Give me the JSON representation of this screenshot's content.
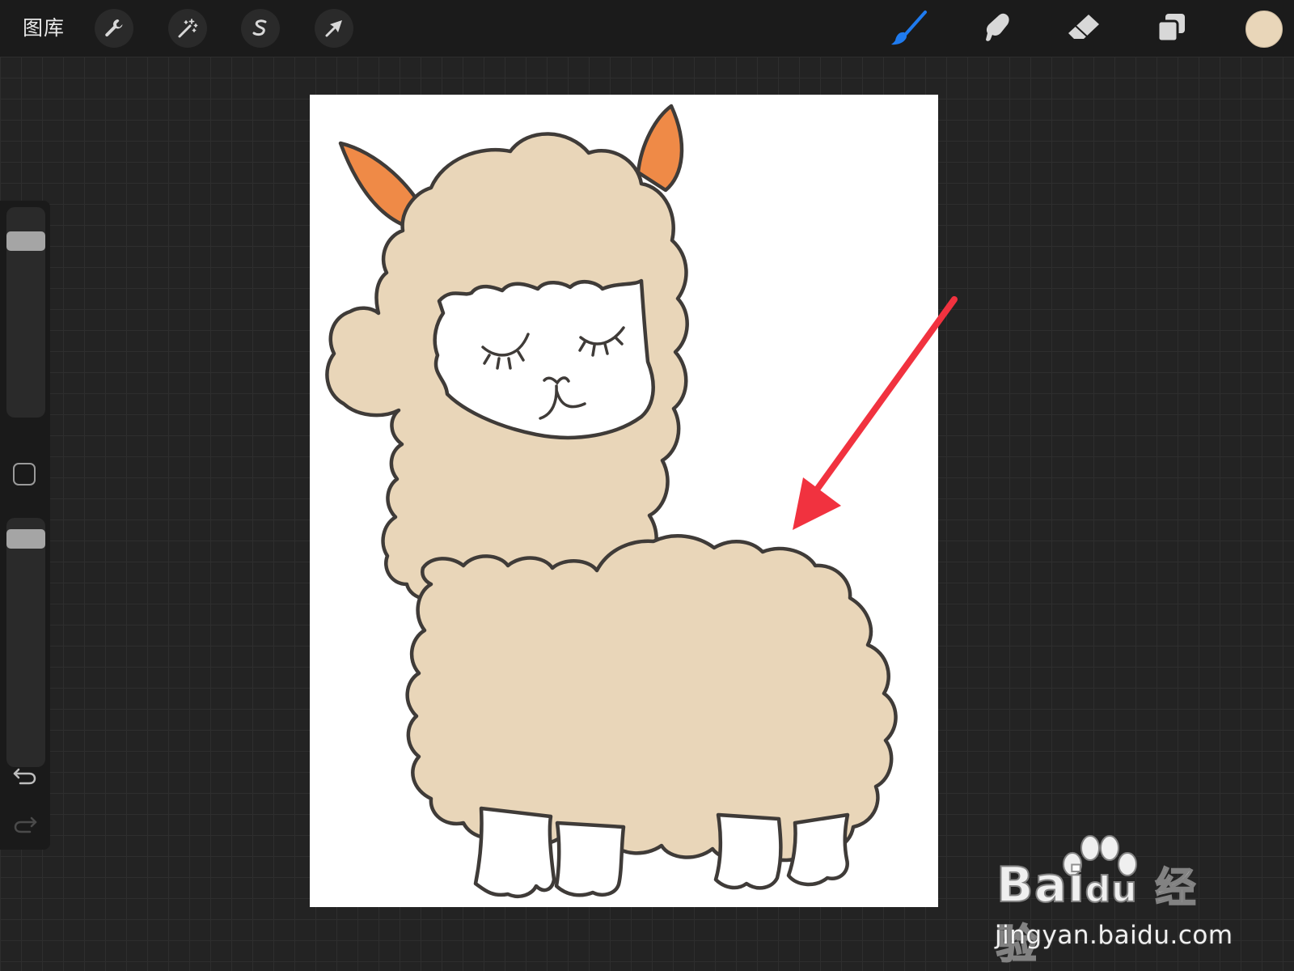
{
  "topbar": {
    "gallery_label": "图库",
    "left_tools": [
      {
        "name": "actions",
        "icon": "wrench-icon"
      },
      {
        "name": "adjustments",
        "icon": "magic-wand-icon"
      },
      {
        "name": "selection",
        "icon": "selection-s-icon"
      },
      {
        "name": "transform",
        "icon": "arrow-cursor-icon"
      }
    ],
    "right_tools": [
      {
        "name": "brush",
        "icon": "brush-icon",
        "active": true
      },
      {
        "name": "smudge",
        "icon": "smudge-finger-icon"
      },
      {
        "name": "eraser",
        "icon": "eraser-icon"
      },
      {
        "name": "layers",
        "icon": "layers-icon"
      }
    ],
    "current_color": "#e9d6b9"
  },
  "sidebar": {
    "brush_size_level": 0.92,
    "opacity_level": 0.95,
    "undo_icon": "undo-arrow-icon",
    "redo_icon": "redo-arrow-icon"
  },
  "canvas": {
    "artwork": "alpaca-drawing",
    "fill_color": "#e9d6b9",
    "ear_color": "#ef8a47",
    "annotation_arrow_color": "#f1323f"
  },
  "watermark": {
    "brand_text": "Bai du 经验",
    "brand_part1": "Bai",
    "brand_part2": "du",
    "brand_part3": "经验",
    "url": "jingyan.baidu.com"
  },
  "colors": {
    "accent_blue": "#1f7bef",
    "toolbar_bg": "#1b1b1b",
    "workspace_bg": "#232323"
  }
}
